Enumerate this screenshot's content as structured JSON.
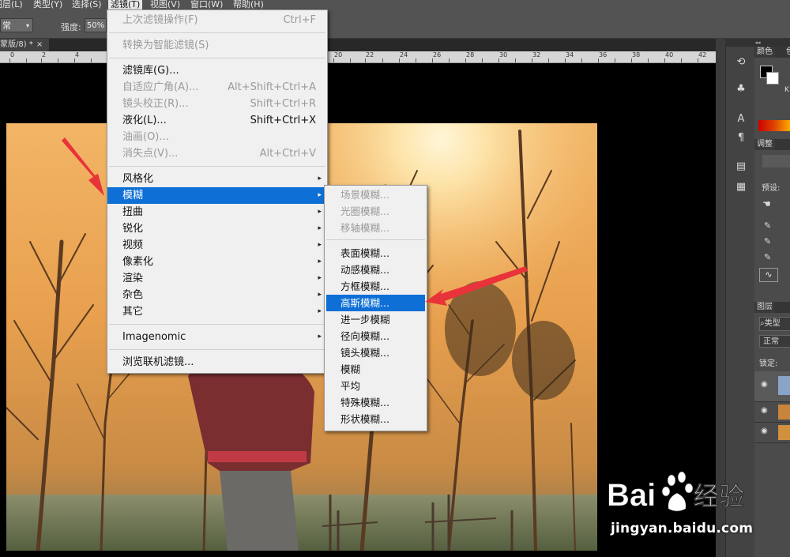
{
  "menubar": {
    "items": [
      "图层(L)",
      "类型(Y)",
      "选择(S)",
      "滤镜(T)",
      "视图(V)",
      "窗口(W)",
      "帮助(H)"
    ],
    "active_index": 3
  },
  "options": {
    "mode": "常",
    "strength_label": "强度:",
    "strength_value": "50%"
  },
  "document": {
    "tab_title": "蒙版/8) *",
    "close": "×"
  },
  "ruler": {
    "labels": [
      "0",
      "2",
      "4",
      "20",
      "22",
      "24",
      "26",
      "28",
      "30",
      "32",
      "34",
      "36",
      "38",
      "40",
      "42"
    ]
  },
  "filter_menu": {
    "items": [
      {
        "label": "上次滤镜操作(F)",
        "shortcut": "Ctrl+F",
        "disabled": true
      },
      {
        "label": "转换为智能滤镜(S)",
        "shortcut": "",
        "disabled": true
      },
      {
        "label": "滤镜库(G)...",
        "shortcut": "",
        "disabled": false
      },
      {
        "label": "自适应广角(A)...",
        "shortcut": "Alt+Shift+Ctrl+A",
        "disabled": true
      },
      {
        "label": "镜头校正(R)...",
        "shortcut": "Shift+Ctrl+R",
        "disabled": true
      },
      {
        "label": "液化(L)...",
        "shortcut": "Shift+Ctrl+X",
        "disabled": false
      },
      {
        "label": "油画(O)...",
        "shortcut": "",
        "disabled": true
      },
      {
        "label": "消失点(V)...",
        "shortcut": "Alt+Ctrl+V",
        "disabled": true
      },
      {
        "label": "风格化",
        "submenu": true
      },
      {
        "label": "模糊",
        "submenu": true,
        "selected": true
      },
      {
        "label": "扭曲",
        "submenu": true
      },
      {
        "label": "锐化",
        "submenu": true
      },
      {
        "label": "视频",
        "submenu": true
      },
      {
        "label": "像素化",
        "submenu": true
      },
      {
        "label": "渲染",
        "submenu": true
      },
      {
        "label": "杂色",
        "submenu": true
      },
      {
        "label": "其它",
        "submenu": true
      },
      {
        "label": "Imagenomic",
        "submenu": true
      },
      {
        "label": "浏览联机滤镜..."
      }
    ]
  },
  "blur_submenu": {
    "items": [
      {
        "label": "场景模糊...",
        "disabled": true
      },
      {
        "label": "光圈模糊...",
        "disabled": true
      },
      {
        "label": "移轴模糊...",
        "disabled": true
      },
      {
        "label": "表面模糊..."
      },
      {
        "label": "动感模糊..."
      },
      {
        "label": "方框模糊..."
      },
      {
        "label": "高斯模糊...",
        "selected": true
      },
      {
        "label": "进一步模糊"
      },
      {
        "label": "径向模糊..."
      },
      {
        "label": "镜头模糊..."
      },
      {
        "label": "模糊"
      },
      {
        "label": "平均"
      },
      {
        "label": "特殊模糊..."
      },
      {
        "label": "形状模糊..."
      }
    ]
  },
  "right_panel": {
    "collapse": "◂◂",
    "color_tab": "颜色",
    "color_tab2": "色",
    "adjust_tab": "调整",
    "preset_label": "预设:",
    "layers_tab": "图层",
    "layer_kind": "类型",
    "blend_mode": "正常",
    "lock_label": "锁定:",
    "k_label": "K"
  },
  "icons": {
    "menu_arrow": "▸",
    "dropdown": "▾",
    "eye": "👁"
  },
  "colors": {
    "menu_highlight": "#0e6fd6",
    "annotation_arrow": "#e8333a",
    "menu_bg": "#f0f0f0"
  },
  "watermark": {
    "brand_left": "Bai",
    "brand_right": "经验",
    "url": "jingyan.baidu.com"
  }
}
